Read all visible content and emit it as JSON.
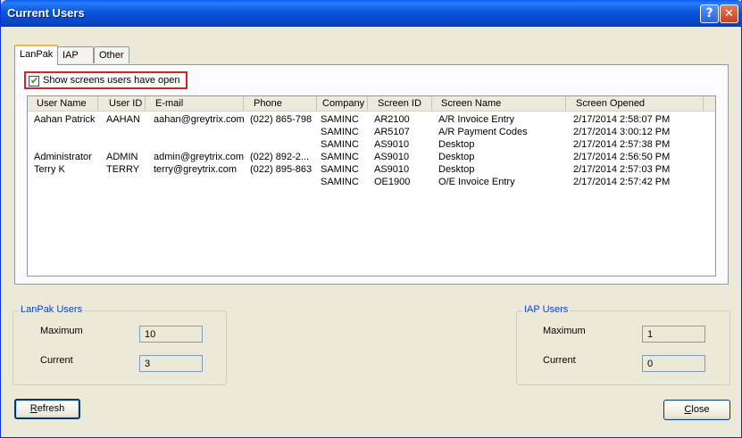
{
  "window": {
    "title": "Current Users",
    "help_label": "?",
    "close_label": "✕"
  },
  "tabs": [
    {
      "label": "LanPak"
    },
    {
      "label": "IAP"
    },
    {
      "label": "Other"
    }
  ],
  "options": {
    "show_screens_label": "Show screens users have open",
    "show_screens_checked": true,
    "check_glyph": "✔"
  },
  "table": {
    "columns": [
      "User Name",
      "User ID",
      "E-mail",
      "Phone",
      "Company",
      "Screen ID",
      "Screen Name",
      "Screen Opened"
    ],
    "rows": [
      [
        "Aahan Patrick",
        "AAHAN",
        "aahan@greytrix.com",
        "(022) 865-798",
        "SAMINC",
        "AR2100",
        "A/R Invoice Entry",
        "2/17/2014 2:58:07 PM"
      ],
      [
        "",
        "",
        "",
        "",
        "SAMINC",
        "AR5107",
        "A/R Payment Codes",
        "2/17/2014 3:00:12 PM"
      ],
      [
        "",
        "",
        "",
        "",
        "SAMINC",
        "AS9010",
        "Desktop",
        "2/17/2014 2:57:38 PM"
      ],
      [
        "Administrator",
        "ADMIN",
        "admin@greytrix.com",
        "(022) 892-2...",
        "SAMINC",
        "AS9010",
        "Desktop",
        "2/17/2014 2:56:50 PM"
      ],
      [
        "Terry K",
        "TERRY",
        "terry@greytrix.com",
        "(022) 895-863",
        "SAMINC",
        "AS9010",
        "Desktop",
        "2/17/2014 2:57:03 PM"
      ],
      [
        "",
        "",
        "",
        "",
        "SAMINC",
        "OE1900",
        "O/E Invoice Entry",
        "2/17/2014 2:57:42 PM"
      ]
    ]
  },
  "lanpak_users": {
    "title": "LanPak Users",
    "maximum_label": "Maximum",
    "maximum_value": "10",
    "current_label": "Current",
    "current_value": "3"
  },
  "iap_users": {
    "title": "IAP Users",
    "maximum_label": "Maximum",
    "maximum_value": "1",
    "current_label": "Current",
    "current_value": "0"
  },
  "buttons": {
    "refresh_mnemonic": "R",
    "refresh_rest": "efresh",
    "close_mnemonic": "C",
    "close_rest": "lose"
  },
  "colors": {
    "title_bar": "#0a54e3",
    "highlight_border": "#e02020",
    "group_title": "#0046d5",
    "window_bg": "#ece9d8"
  }
}
